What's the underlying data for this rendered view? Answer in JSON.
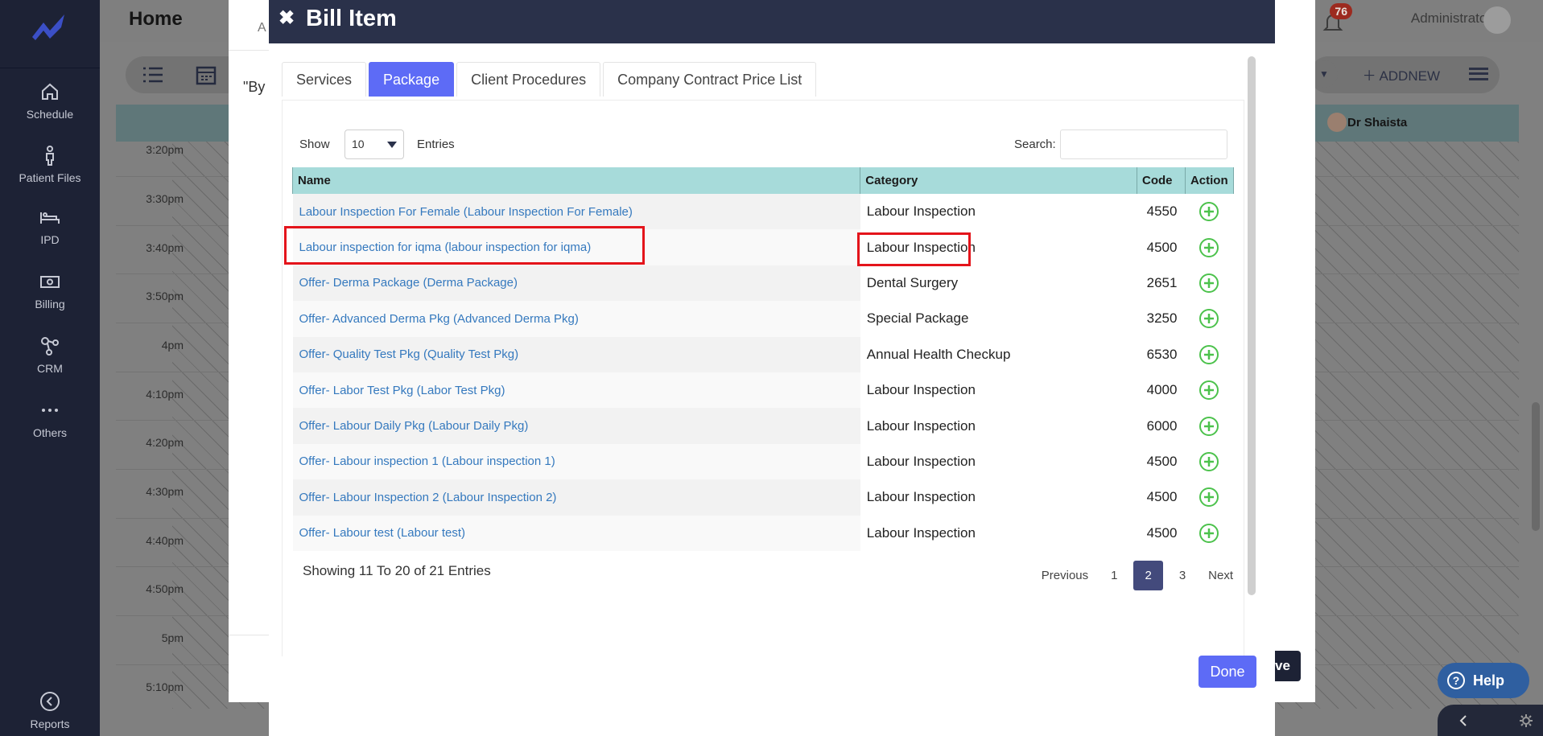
{
  "sidebar": {
    "items": [
      {
        "label": "Schedule",
        "icon": "home-icon"
      },
      {
        "label": "Patient Files",
        "icon": "person-icon"
      },
      {
        "label": "IPD",
        "icon": "bed-icon"
      },
      {
        "label": "Billing",
        "icon": "money-icon"
      },
      {
        "label": "CRM",
        "icon": "network-icon"
      },
      {
        "label": "Others",
        "icon": "dots-icon"
      },
      {
        "label": "Reports",
        "icon": "reports-icon"
      }
    ]
  },
  "app": {
    "title": "Home",
    "user": "Administrator",
    "notification_count": "76",
    "addnew_label": "ADDNEW",
    "doctor": "Dr Shaista",
    "times": [
      "3:20pm",
      "3:30pm",
      "3:40pm",
      "3:50pm",
      "4pm",
      "4:10pm",
      "4:20pm",
      "4:30pm",
      "4:40pm",
      "4:50pm",
      "5pm",
      "5:10pm"
    ]
  },
  "outer_modal": {
    "fragment_text": "\"By",
    "fragment_top": "A",
    "save_fragment": "ve"
  },
  "bill_modal": {
    "title": "Bill Item",
    "tabs": [
      {
        "label": "Services",
        "active": false
      },
      {
        "label": "Package",
        "active": true
      },
      {
        "label": "Client Procedures",
        "active": false
      },
      {
        "label": "Company Contract Price List",
        "active": false
      }
    ],
    "show_label": "Show",
    "entries_value": "10",
    "entries_label": "Entries",
    "search_label": "Search:",
    "search_value": "",
    "columns": [
      "Name",
      "Category",
      "Code",
      "Action"
    ],
    "rows": [
      {
        "name": "Labour Inspection For Female (Labour Inspection For Female)",
        "category": "Labour Inspection",
        "code": "4550"
      },
      {
        "name": "Labour inspection for iqma (labour inspection for iqma)",
        "category": "Labour Inspection",
        "code": "4500"
      },
      {
        "name": "Offer- Derma Package (Derma Package)",
        "category": "Dental Surgery",
        "code": "2651"
      },
      {
        "name": "Offer- Advanced Derma Pkg (Advanced Derma Pkg)",
        "category": "Special Package",
        "code": "3250"
      },
      {
        "name": "Offer- Quality Test Pkg (Quality Test Pkg)",
        "category": "Annual Health Checkup",
        "code": "6530"
      },
      {
        "name": "Offer- Labor Test Pkg (Labor Test Pkg)",
        "category": "Labour Inspection",
        "code": "4000"
      },
      {
        "name": "Offer- Labour Daily Pkg (Labour Daily Pkg)",
        "category": "Labour Inspection",
        "code": "6000"
      },
      {
        "name": "Offer- Labour inspection 1 (Labour inspection 1)",
        "category": "Labour Inspection",
        "code": "4500"
      },
      {
        "name": "Offer- Labour Inspection 2 (Labour Inspection 2)",
        "category": "Labour Inspection",
        "code": "4500"
      },
      {
        "name": "Offer- Labour test (Labour test)",
        "category": "Labour Inspection",
        "code": "4500"
      }
    ],
    "showing_text": "Showing 11 To 20 of 21 Entries",
    "pagination": {
      "previous": "Previous",
      "pages": [
        "1",
        "2",
        "3"
      ],
      "current": "2",
      "next": "Next"
    },
    "done_label": "Done"
  },
  "help_label": "Help",
  "colors": {
    "sidebar": "#1d2235",
    "modal_header": "#2a314a",
    "accent": "#5d6bf6",
    "table_header": "#a7dbda",
    "link": "#3579be",
    "add_icon": "#4cc24c",
    "highlight": "#e4141b"
  }
}
